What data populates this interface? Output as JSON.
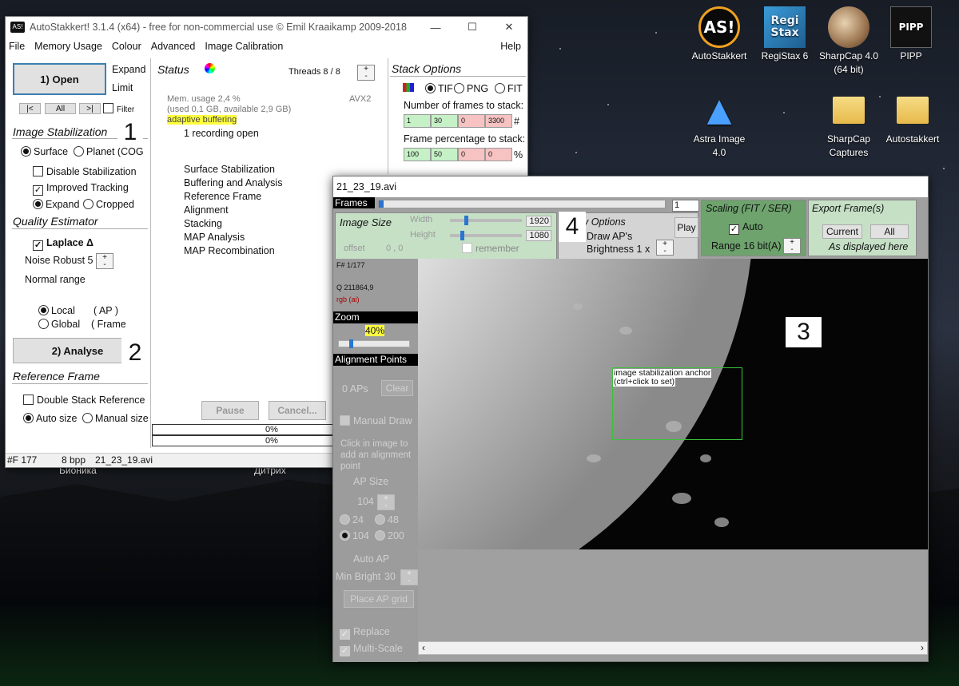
{
  "desktop": {
    "icons": [
      {
        "label": "AutoStakkert",
        "icon": "autostakkert-icon"
      },
      {
        "label": "RegiStax 6",
        "icon": "registax-icon"
      },
      {
        "label": "SharpCap 4.0 (64 bit)",
        "icon": "sharpcap-icon"
      },
      {
        "label": "PIPP",
        "icon": "pipp-icon"
      },
      {
        "label": "Astra Image 4.0",
        "icon": "astra-icon"
      },
      {
        "label": "SharpCap Captures",
        "icon": "folder-icon"
      },
      {
        "label": "Autostakkert",
        "icon": "folder-icon"
      }
    ],
    "bg_labels": [
      "Бионика",
      "Дитрих"
    ]
  },
  "main": {
    "title": "AutoStakkert! 3.1.4 (x64) - free for non-commercial use © Emil Kraaikamp 2009-2018",
    "menu": [
      "File",
      "Memory Usage",
      "Colour",
      "Advanced",
      "Image Calibration",
      "Help"
    ],
    "open_btn": "1) Open",
    "expand": "Expand",
    "limit": "Limit",
    "nav": [
      "|<",
      "All",
      ">|"
    ],
    "filter": "Filter",
    "img_stab_title": "Image Stabilization",
    "surface": "Surface",
    "planet": "Planet (COG",
    "disable_stab": "Disable Stabilization",
    "improved_tracking": "Improved Tracking",
    "expand2": "Expand",
    "cropped": "Cropped",
    "quality_title": "Quality Estimator",
    "laplace": "Laplace Δ",
    "noise_robust": "Noise Robust 5",
    "normal_range": "Normal range",
    "local": "Local",
    "local_ap": "( AP )",
    "global": "Global",
    "global_frame": "( Frame",
    "analyse_btn": "2) Analyse",
    "ref_title": "Reference Frame",
    "double_stack": "Double Stack Reference",
    "auto_size": "Auto size",
    "manual_size": "Manual size",
    "status_title": "Status",
    "threads": "Threads 8 / 8",
    "mem_usage": "Mem. usage 2,4 %",
    "mem_detail": "(used 0,1 GB, available 2,9 GB)",
    "avx": "AVX2",
    "adaptive": "adaptive buffering",
    "recording": "1 recording open",
    "steps": [
      "Surface Stabilization",
      "Buffering and Analysis",
      "Reference Frame",
      "Alignment",
      "Stacking",
      "MAP Analysis",
      "MAP Recombination"
    ],
    "pause": "Pause",
    "cancel": "Cancel...",
    "progress1": "0%",
    "progress2": "0%",
    "stack_title": "Stack Options",
    "tif": "TIF",
    "png": "PNG",
    "fit": "FIT",
    "frames_to_stack": "Number of frames to stack:",
    "frames_values": [
      "1",
      "30",
      "0",
      "3300"
    ],
    "frames_unit": "#",
    "pct_to_stack": "Frame percentage to stack:",
    "pct_values": [
      "100",
      "50",
      "0",
      "0"
    ],
    "pct_unit": "%",
    "status_bar": [
      "#F 177",
      "8 bpp",
      "21_23_19.avi"
    ],
    "markers": [
      "1",
      "2"
    ]
  },
  "viewer": {
    "title": "21_23_19.avi",
    "frames_label": "Frames",
    "frame_num": "1",
    "image_size": "Image Size",
    "width_label": "Width",
    "height_label": "Height",
    "width_val": "1920",
    "height_val": "1080",
    "offset": "offset",
    "offset_vals": "0 , 0",
    "remember": "remember",
    "display_options": "y Options",
    "draw_aps": "Draw AP's",
    "brightness": "Brightness 1 x",
    "play": "Play",
    "scaling_title": "Scaling (FIT / SER)",
    "auto": "Auto",
    "range": "Range 16 bit(A)",
    "export_title": "Export Frame(s)",
    "current": "Current",
    "all": "All",
    "as_displayed": "As displayed here",
    "frame_info": "F# 1/177",
    "q_value": "Q  211864,9",
    "rgb": "rgb (ai)",
    "zoom_title": "Zoom",
    "zoom_value": "40%",
    "ap_title": "Alignment Points",
    "aps": "0 APs",
    "clear": "Clear",
    "manual_draw": "Manual Draw",
    "click_hint": "Click in image to add an alignment point",
    "ap_size": "AP Size",
    "ap_size_val": "104",
    "ap_sizes": [
      "24",
      "48",
      "104",
      "200"
    ],
    "auto_ap": "Auto AP",
    "min_bright": "Min Bright",
    "min_bright_val": "30",
    "place_grid": "Place AP grid",
    "replace": "Replace",
    "multi_scale": "Multi-Scale",
    "anchor_text": "image stabilization anchor",
    "anchor_hint": "(ctrl+click to set)",
    "markers": [
      "3",
      "4"
    ]
  }
}
